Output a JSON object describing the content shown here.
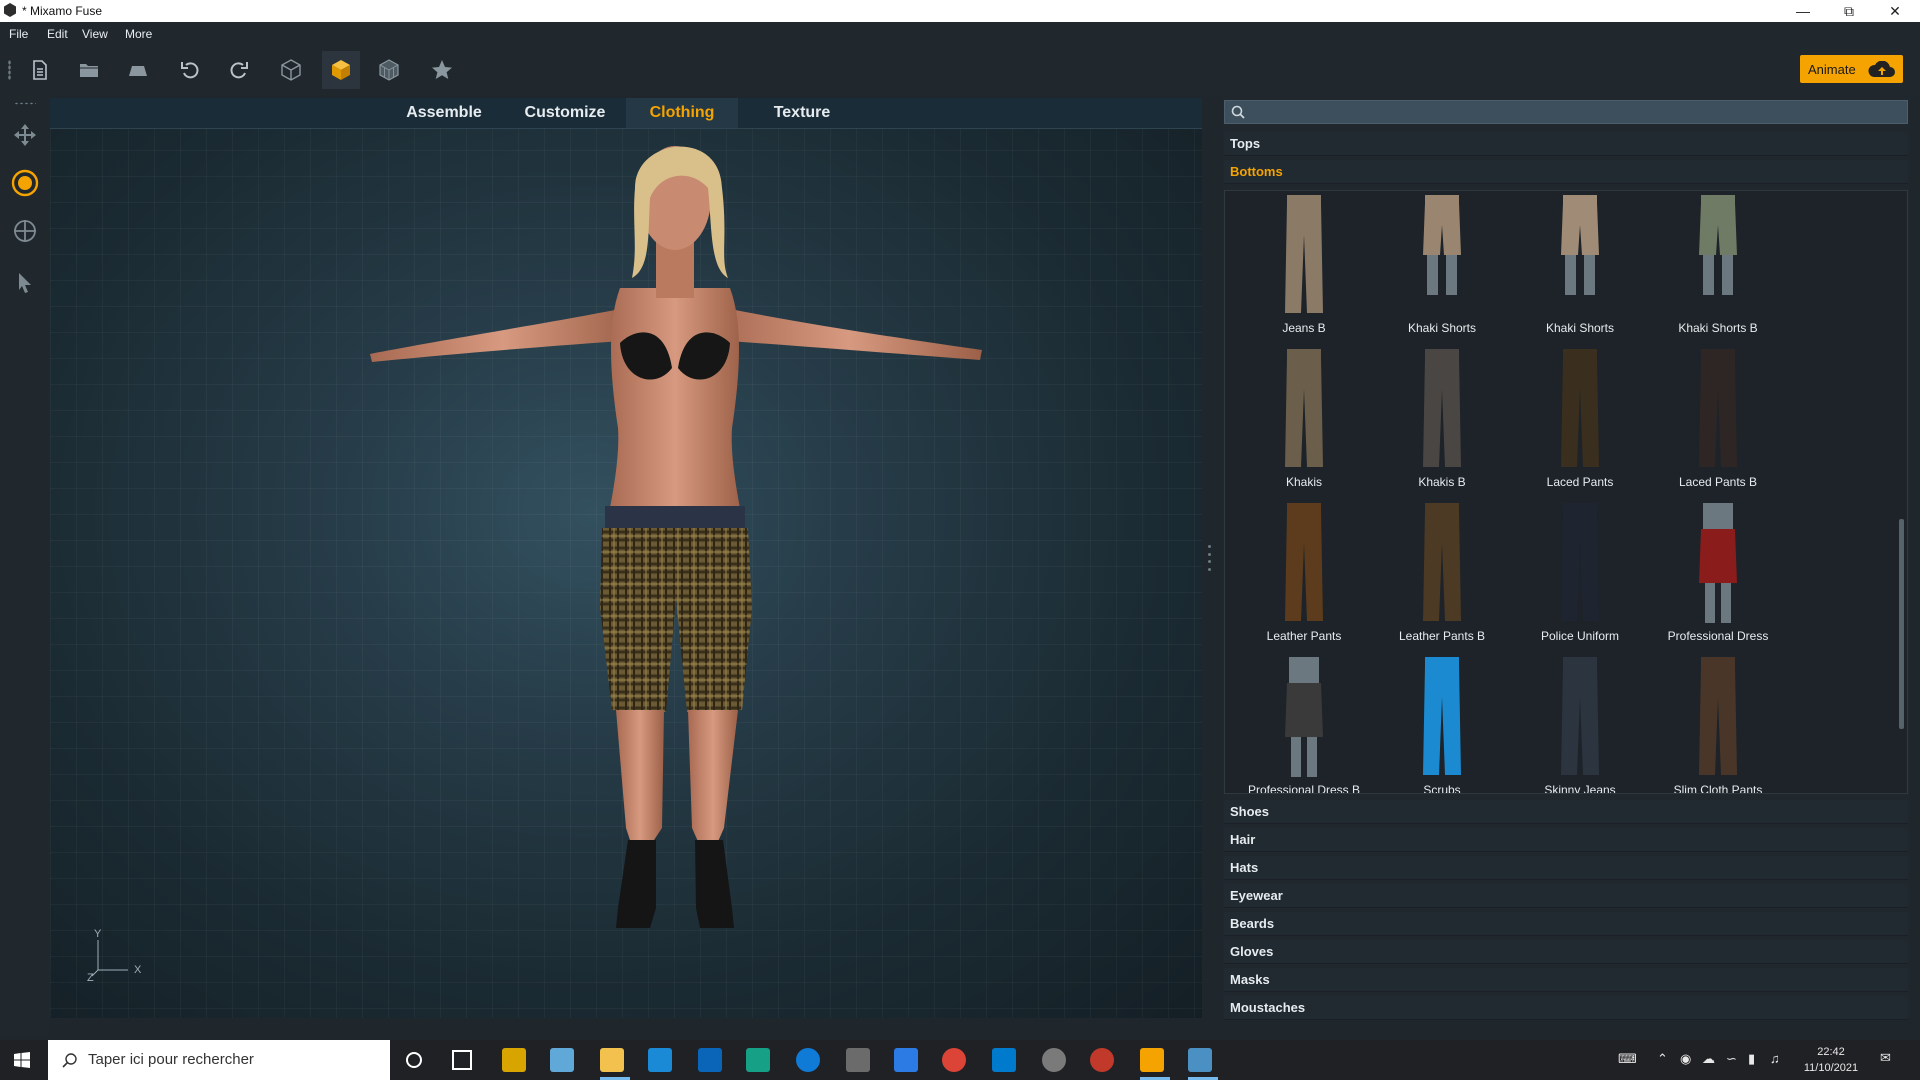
{
  "window": {
    "title": "* Mixamo Fuse",
    "controls": [
      "minimize-icon",
      "restore-icon",
      "close-icon"
    ]
  },
  "menu": [
    "File",
    "Edit",
    "View",
    "More"
  ],
  "toolbar": {
    "animate_label": "Animate",
    "accent": "#f4a300",
    "buttons": [
      "new-file-icon",
      "open-folder-icon",
      "save-icon",
      "undo-icon",
      "redo-icon",
      "wireframe-cube-icon",
      "solid-cube-icon",
      "grid-cube-icon",
      "star-icon"
    ]
  },
  "left_tools": [
    "move-icon",
    "rotate-icon",
    "target-icon",
    "pointer-icon"
  ],
  "tabs": [
    {
      "label": "Assemble",
      "active": false
    },
    {
      "label": "Customize",
      "active": false
    },
    {
      "label": "Clothing",
      "active": true
    },
    {
      "label": "Texture",
      "active": false
    }
  ],
  "viewport": {
    "axis_y": "Y",
    "axis_x": "X",
    "axis_z": "Z"
  },
  "panel": {
    "search_placeholder": "",
    "categories_top": [
      {
        "label": "Tops",
        "active": false
      },
      {
        "label": "Bottoms",
        "active": true
      }
    ],
    "items": [
      {
        "label": "Jeans B",
        "color": "#8a7a66"
      },
      {
        "label": "Khaki Shorts",
        "color": "#9a8670"
      },
      {
        "label": "Khaki Shorts",
        "color": "#a08c76"
      },
      {
        "label": "Khaki Shorts B",
        "color": "#6f7b64"
      },
      {
        "label": "Khakis",
        "color": "#6b5e4a"
      },
      {
        "label": "Khakis B",
        "color": "#4a4644"
      },
      {
        "label": "Laced Pants",
        "color": "#3a2e1e"
      },
      {
        "label": "Laced Pants B",
        "color": "#2e2624"
      },
      {
        "label": "Leather Pants",
        "color": "#5c3c1c"
      },
      {
        "label": "Leather Pants B",
        "color": "#4c3a24"
      },
      {
        "label": "Police Uniform",
        "color": "#1e2430"
      },
      {
        "label": "Professional Dress",
        "color": "#8a1c1c"
      },
      {
        "label": "Professional Dress B",
        "color": "#3a3a3a"
      },
      {
        "label": "Scrubs",
        "color": "#1c8ad0"
      },
      {
        "label": "Skinny Jeans",
        "color": "#2c3440"
      },
      {
        "label": "Slim Cloth Pants",
        "color": "#4a3628"
      }
    ],
    "categories_bottom": [
      "Shoes",
      "Hair",
      "Hats",
      "Eyewear",
      "Beards",
      "Gloves",
      "Masks",
      "Moustaches"
    ]
  },
  "taskbar": {
    "search_placeholder": "Taper ici pour rechercher",
    "time": "22:42",
    "date": "11/10/2021"
  }
}
